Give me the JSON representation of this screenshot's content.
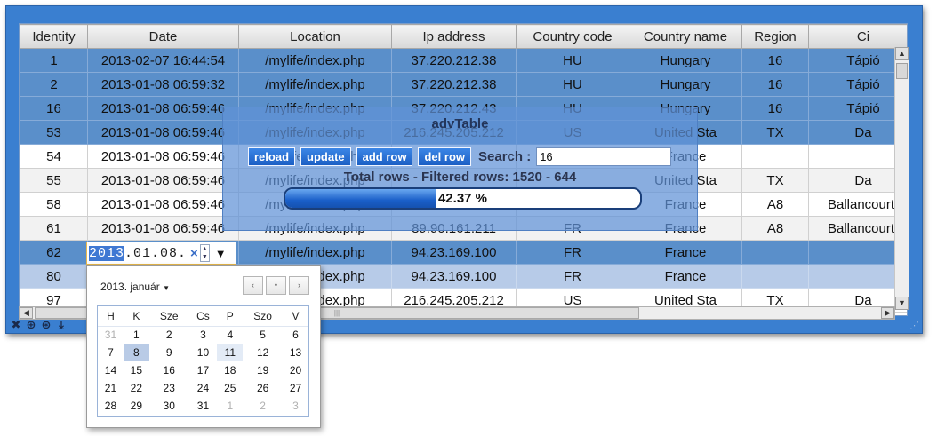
{
  "columns": [
    "Identity",
    "Date",
    "Location",
    "Ip address",
    "Country code",
    "Country name",
    "Region",
    "Ci"
  ],
  "rows": [
    {
      "style": "sel",
      "cells": [
        "1",
        "2013-02-07 16:44:54",
        "/mylife/index.php",
        "37.220.212.38",
        "HU",
        "Hungary",
        "16",
        "Tápió"
      ]
    },
    {
      "style": "sel",
      "cells": [
        "2",
        "2013-01-08 06:59:32",
        "/mylife/index.php",
        "37.220.212.38",
        "HU",
        "Hungary",
        "16",
        "Tápió"
      ]
    },
    {
      "style": "sel",
      "cells": [
        "16",
        "2013-01-08 06:59:46",
        "/mylife/index.php",
        "37.220.212.43",
        "HU",
        "Hungary",
        "16",
        "Tápió"
      ]
    },
    {
      "style": "sel",
      "cells": [
        "53",
        "2013-01-08 06:59:46",
        "/mylife/index.php",
        "216.245.205.212",
        "US",
        "United Sta",
        "TX",
        "Da"
      ]
    },
    {
      "style": "white",
      "cells": [
        "54",
        "2013-01-08 06:59:46",
        "/mylife/index.php",
        "",
        "",
        "France",
        "",
        ""
      ]
    },
    {
      "style": "alt",
      "cells": [
        "55",
        "2013-01-08 06:59:46",
        "/mylife/index.php",
        "",
        "",
        "United Sta",
        "TX",
        "Da"
      ]
    },
    {
      "style": "white",
      "cells": [
        "58",
        "2013-01-08 06:59:46",
        "/mylife/index.php",
        "",
        "",
        "France",
        "A8",
        "Ballancourt-"
      ]
    },
    {
      "style": "alt",
      "cells": [
        "61",
        "2013-01-08 06:59:46",
        "/mylife/index.php",
        "89.90.161.211",
        "FR",
        "France",
        "A8",
        "Ballancourt-"
      ]
    },
    {
      "style": "sel",
      "cells": [
        "62",
        "",
        "/mylife/index.php",
        "94.23.169.100",
        "FR",
        "France",
        "",
        ""
      ]
    },
    {
      "style": "pale",
      "cells": [
        "80",
        "",
        "/mylife/index.php",
        "94.23.169.100",
        "FR",
        "France",
        "",
        ""
      ]
    },
    {
      "style": "white",
      "cells": [
        "97",
        "",
        "/mylife/index.php",
        "216.245.205.212",
        "US",
        "United Sta",
        "TX",
        "Da"
      ]
    }
  ],
  "overlay": {
    "title": "advTable",
    "buttons": {
      "reload": "reload",
      "update": "update",
      "add_row": "add row",
      "del_row": "del row"
    },
    "search_label": "Search :",
    "search_value": "16",
    "totals": "Total rows - Filtered rows: 1520 - 644",
    "progress_label": "42.37 %",
    "progress_fraction": 0.4237
  },
  "date_editor": {
    "year": "2013",
    "rest": ".01.08.",
    "clear_icon": "×",
    "dropdown_icon": "▼"
  },
  "calendar": {
    "month_label": "2013. január",
    "weekday_headers": [
      "H",
      "K",
      "Sze",
      "Cs",
      "P",
      "Szo",
      "V"
    ],
    "weeks": [
      [
        {
          "d": "31",
          "m": true
        },
        {
          "d": "1"
        },
        {
          "d": "2"
        },
        {
          "d": "3"
        },
        {
          "d": "4"
        },
        {
          "d": "5"
        },
        {
          "d": "6"
        }
      ],
      [
        {
          "d": "7"
        },
        {
          "d": "8",
          "chosen": true
        },
        {
          "d": "9"
        },
        {
          "d": "10"
        },
        {
          "d": "11",
          "today": true
        },
        {
          "d": "12"
        },
        {
          "d": "13"
        }
      ],
      [
        {
          "d": "14"
        },
        {
          "d": "15"
        },
        {
          "d": "16"
        },
        {
          "d": "17"
        },
        {
          "d": "18"
        },
        {
          "d": "19"
        },
        {
          "d": "20"
        }
      ],
      [
        {
          "d": "21"
        },
        {
          "d": "22"
        },
        {
          "d": "23"
        },
        {
          "d": "24"
        },
        {
          "d": "25"
        },
        {
          "d": "26"
        },
        {
          "d": "27"
        }
      ],
      [
        {
          "d": "28"
        },
        {
          "d": "29"
        },
        {
          "d": "30"
        },
        {
          "d": "31"
        },
        {
          "d": "1",
          "m": true
        },
        {
          "d": "2",
          "m": true
        },
        {
          "d": "3",
          "m": true
        }
      ]
    ],
    "nav_icons": [
      "‹",
      "•",
      "›"
    ]
  },
  "toolbar_icons": [
    "✖",
    "⊕",
    "⊛",
    "⤓"
  ],
  "colors": {
    "window": "#3a7fd0",
    "selected_row": "#5a8fca",
    "pale_row": "#b7cbe8",
    "progress": "#1a5fc8"
  }
}
